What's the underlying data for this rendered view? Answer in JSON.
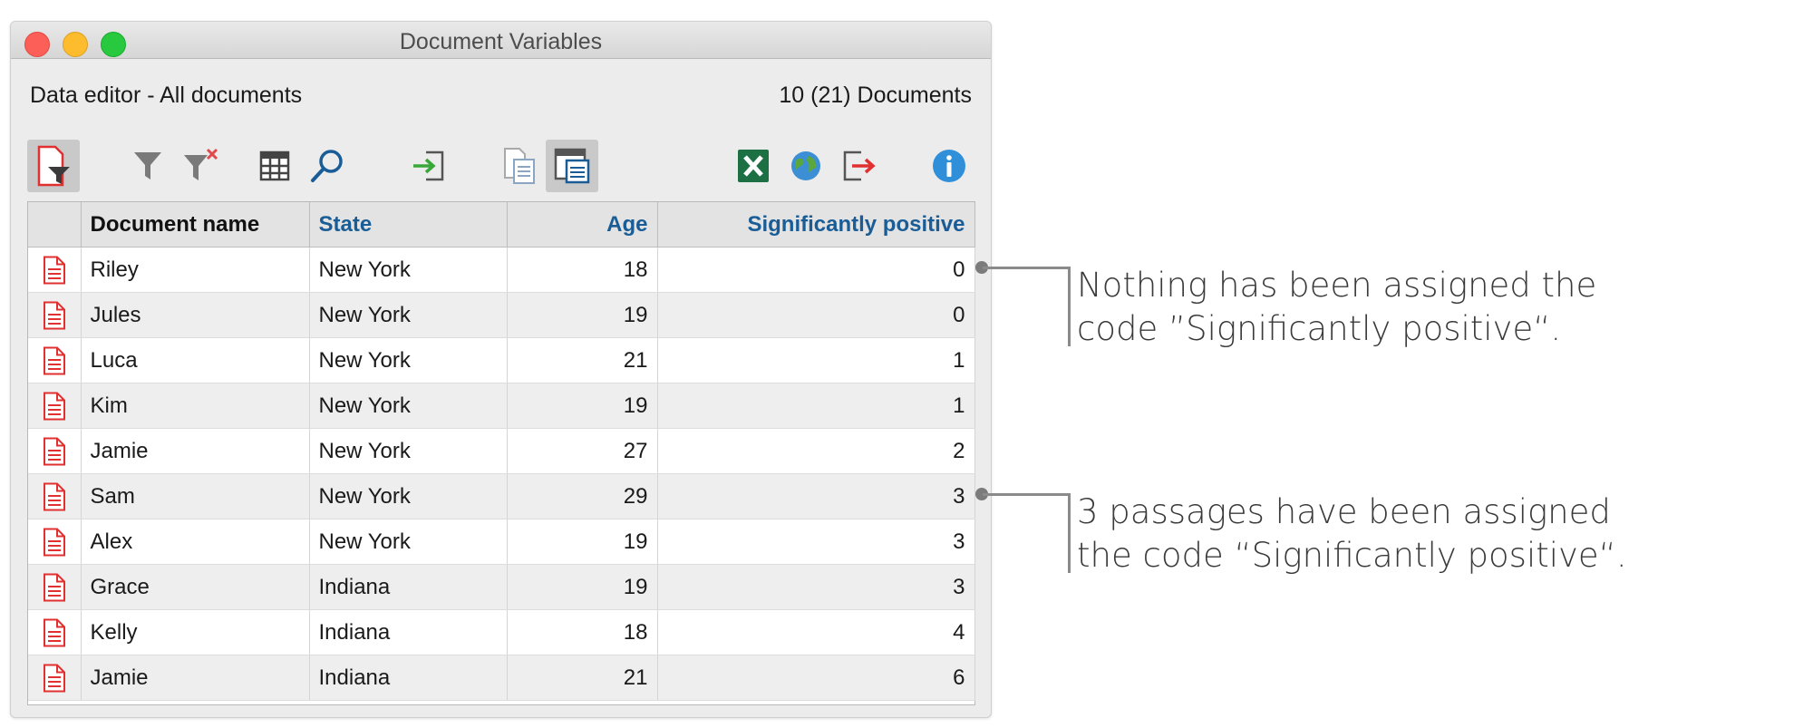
{
  "window": {
    "title": "Document Variables",
    "subtitle": "Data editor - All documents",
    "doc_count": "10 (21) Documents"
  },
  "toolbar": [
    {
      "name": "filter-documents-icon",
      "active": true
    },
    {
      "name": "funnel-icon",
      "active": false
    },
    {
      "name": "clear-filter-icon",
      "active": false
    },
    {
      "name": "columns-icon",
      "active": false
    },
    {
      "name": "search-icon",
      "active": false
    },
    {
      "name": "import-icon",
      "active": false
    },
    {
      "name": "document-list-icon",
      "active": false
    },
    {
      "name": "document-view-icon",
      "active": true
    },
    {
      "name": "excel-export-icon",
      "active": false
    },
    {
      "name": "web-export-icon",
      "active": false
    },
    {
      "name": "export-icon",
      "active": false
    },
    {
      "name": "info-icon",
      "active": false
    }
  ],
  "table": {
    "columns": [
      "Document name",
      "State",
      "Age",
      "Significantly positive"
    ],
    "rows": [
      {
        "name": "Riley",
        "state": "New York",
        "age": "18",
        "sig": "0"
      },
      {
        "name": "Jules",
        "state": "New York",
        "age": "19",
        "sig": "0"
      },
      {
        "name": "Luca",
        "state": "New York",
        "age": "21",
        "sig": "1"
      },
      {
        "name": "Kim",
        "state": "New York",
        "age": "19",
        "sig": "1"
      },
      {
        "name": "Jamie",
        "state": "New York",
        "age": "27",
        "sig": "2"
      },
      {
        "name": "Sam",
        "state": "New York",
        "age": "29",
        "sig": "3"
      },
      {
        "name": "Alex",
        "state": "New York",
        "age": "19",
        "sig": "3"
      },
      {
        "name": "Grace",
        "state": "Indiana",
        "age": "19",
        "sig": "3"
      },
      {
        "name": "Kelly",
        "state": "Indiana",
        "age": "18",
        "sig": "4"
      },
      {
        "name": "Jamie",
        "state": "Indiana",
        "age": "21",
        "sig": "6"
      }
    ]
  },
  "annotations": [
    {
      "line1": "Nothing has been assigned the",
      "line2": "code ”Significantly positive“."
    },
    {
      "line1": "3 passages have been assigned",
      "line2": "the code “Significantly positive“."
    }
  ],
  "colors": {
    "header_blue": "#1a5d96",
    "doc_icon_red": "#e03030",
    "excel_green": "#1d7044",
    "info_blue": "#2f8fd8"
  }
}
